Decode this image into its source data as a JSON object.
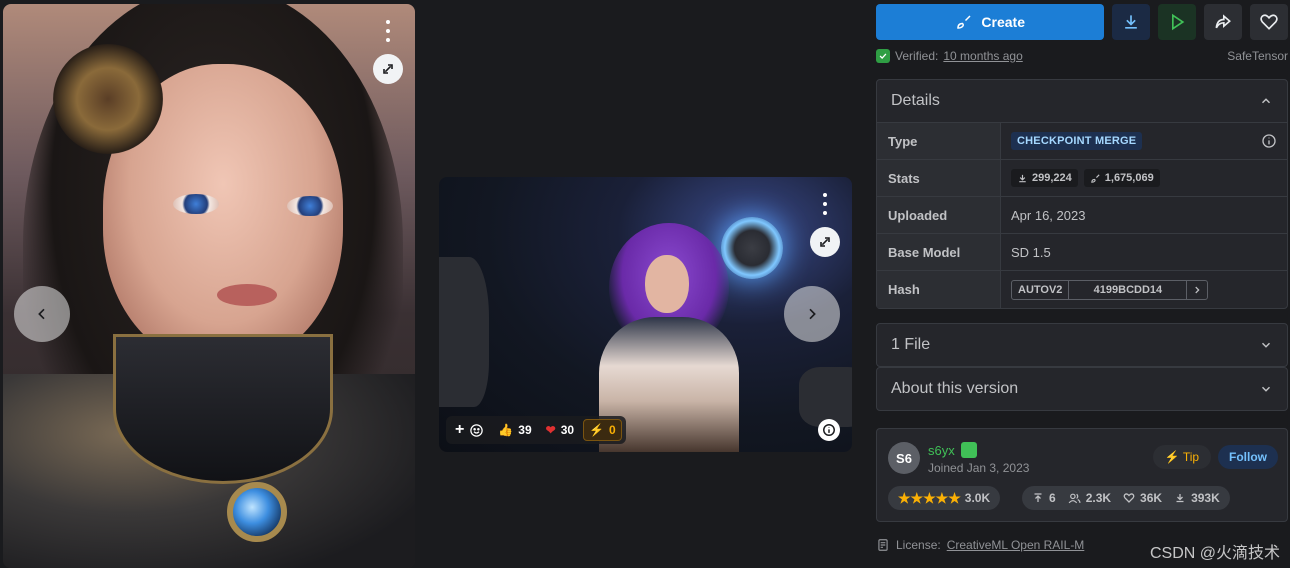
{
  "actions": {
    "create_label": "Create"
  },
  "verified": {
    "prefix": "Verified:",
    "time": "10 months ago",
    "format": "SafeTensor"
  },
  "details": {
    "title": "Details",
    "rows": [
      {
        "key": "Type",
        "value": "CHECKPOINT MERGE"
      },
      {
        "key": "Stats",
        "downloads": "299,224",
        "generations": "1,675,069"
      },
      {
        "key": "Uploaded",
        "value": "Apr 16, 2023"
      },
      {
        "key": "Base Model",
        "value": "SD 1.5"
      },
      {
        "key": "Hash",
        "hash_type": "AUTOV2",
        "hash_value": "4199BCDD14"
      }
    ]
  },
  "files": {
    "label": "1 File"
  },
  "about": {
    "label": "About this version"
  },
  "creator": {
    "initials": "S6",
    "name": "s6yx",
    "joined": "Joined Jan 3, 2023",
    "tip_label": "Tip",
    "follow_label": "Follow",
    "rating_count": "3.0K",
    "uploads": "6",
    "followers": "2.3K",
    "likes": "36K",
    "downloads": "393K"
  },
  "reactions": {
    "likes": "39",
    "hearts": "30",
    "buzz": "0"
  },
  "license": {
    "prefix": "License:",
    "name": "CreativeML Open RAIL-M"
  },
  "watermark": "CSDN @火滴技术",
  "colors": {
    "accent": "#1c7ed6",
    "background": "#1a1b1e",
    "card": "#25262b",
    "verified_green": "#2f9e44",
    "tip_yellow": "#fab005"
  }
}
